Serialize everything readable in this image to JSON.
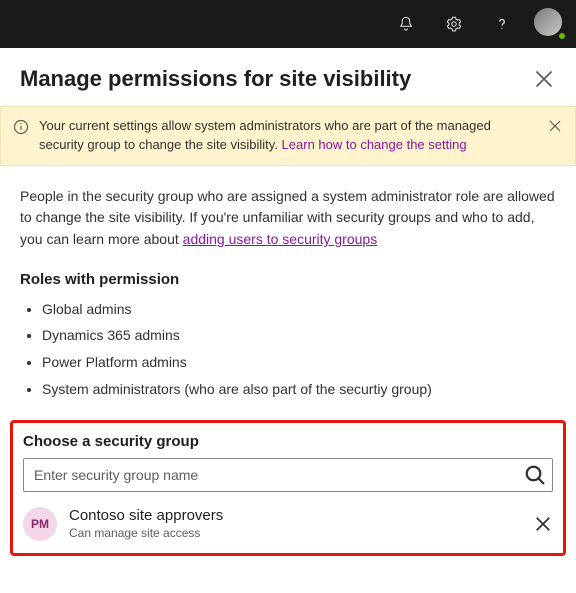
{
  "panel": {
    "title": "Manage permissions for site visibility"
  },
  "banner": {
    "text_before": "Your current settings allow system administrators who are part of the managed security group to change the site visibility. ",
    "link_text": "Learn how to change the setting"
  },
  "body": {
    "text_before": "People in the security group who are assigned a system administrator role are allowed to change the site visibility. If you're unfamiliar with security groups and who to add, you can learn more about ",
    "link_text": "adding users to security groups"
  },
  "roles": {
    "heading": "Roles with permission",
    "items": [
      "Global admins",
      "Dynamics 365 admins",
      "Power Platform admins",
      "System administrators (who are also part of the securtiy group)"
    ]
  },
  "choose": {
    "label": "Choose a security group",
    "placeholder": "Enter security group name"
  },
  "group": {
    "initials": "PM",
    "name": "Contoso site approvers",
    "description": "Can manage site access"
  }
}
